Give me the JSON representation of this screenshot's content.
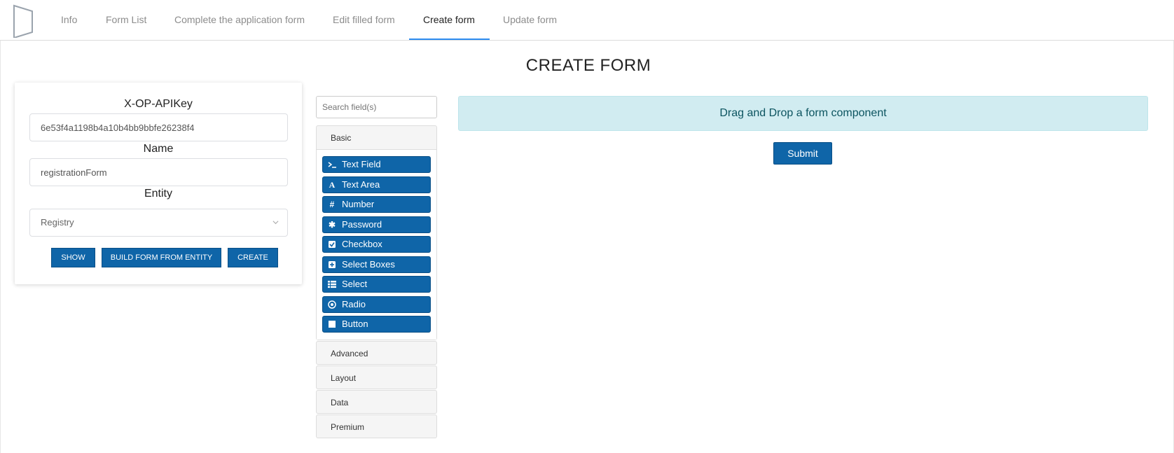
{
  "nav": {
    "tabs": [
      {
        "label": "Info"
      },
      {
        "label": "Form List"
      },
      {
        "label": "Complete the application form"
      },
      {
        "label": "Edit filled form"
      },
      {
        "label": "Create form"
      },
      {
        "label": "Update form"
      }
    ],
    "active_tab": "Create form",
    "accent_color": "#2d8cf0"
  },
  "page": {
    "title": "CREATE FORM"
  },
  "form": {
    "api_key_label": "X-OP-APIKey",
    "api_key_value": "6e53f4a1198b4a10b4bb9bbfe26238f4",
    "name_label": "Name",
    "name_value": "registrationForm",
    "entity_label": "Entity",
    "entity_value": "Registry",
    "entity_icon": "chevron-down-icon",
    "buttons": {
      "show": "SHOW",
      "build": "BUILD FORM FROM ENTITY",
      "create": "CREATE"
    }
  },
  "builder": {
    "search_placeholder": "Search field(s)",
    "groups": [
      {
        "label": "Basic"
      },
      {
        "label": "Advanced"
      },
      {
        "label": "Layout"
      },
      {
        "label": "Data"
      },
      {
        "label": "Premium"
      }
    ],
    "basic_components": [
      {
        "label": "Text Field",
        "icon": "terminal-icon"
      },
      {
        "label": "Text Area",
        "icon": "font-icon"
      },
      {
        "label": "Number",
        "icon": "hashtag-icon"
      },
      {
        "label": "Password",
        "icon": "asterisk-icon"
      },
      {
        "label": "Checkbox",
        "icon": "check-square-icon"
      },
      {
        "label": "Select Boxes",
        "icon": "plus-square-icon"
      },
      {
        "label": "Select",
        "icon": "th-list-icon"
      },
      {
        "label": "Radio",
        "icon": "dot-circle-icon"
      },
      {
        "label": "Button",
        "icon": "stop-icon"
      }
    ],
    "button_color": "#0f65a8"
  },
  "canvas": {
    "drop_hint": "Drag and Drop a form component",
    "drop_zone_color": "#d1ecf1",
    "submit_label": "Submit"
  }
}
